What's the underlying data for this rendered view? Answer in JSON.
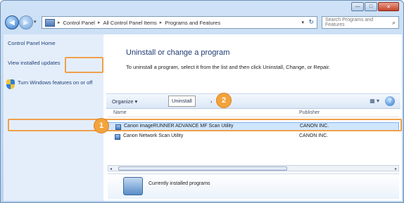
{
  "window": {
    "controls": {
      "minimize": "—",
      "maximize": "□",
      "close": "✕"
    }
  },
  "nav": {
    "back_icon": "◀",
    "forward_icon": "▶",
    "dropdown_icon": "▾",
    "address_parts": [
      "Control Panel",
      "All Control Panel Items",
      "Programs and Features"
    ],
    "address_dropdown_icon": "▾",
    "refresh_icon": "↻",
    "search_placeholder": "Search Programs and Features",
    "search_icon": "⌕"
  },
  "sidebar": {
    "items": [
      {
        "label": "Control Panel Home"
      },
      {
        "label": "View installed updates"
      },
      {
        "label": "Turn Windows features on or off"
      }
    ]
  },
  "main": {
    "title": "Uninstall or change a program",
    "description": "To uninstall a program, select it from the list and then click Uninstall, Change, or Repair.",
    "toolbar": {
      "organize": "Organize ▾",
      "uninstall": "Uninstall",
      "views_icon": "▦ ▾",
      "help_icon": "?"
    },
    "list": {
      "columns": [
        "Name",
        "Publisher"
      ],
      "rows": [
        {
          "name": "Canon imageRUNNER ADVANCE MF Scan Utility",
          "publisher": "CANON INC."
        },
        {
          "name": "Canon Network Scan Utility",
          "publisher": "CANON INC."
        }
      ]
    },
    "scrollbar": {
      "left": "◂",
      "right": "▸"
    },
    "details": {
      "text": "Currently installed programs"
    }
  },
  "callouts": {
    "one": "1",
    "two": "2"
  },
  "colors": {
    "accent": "#f3a33c",
    "link": "#1f3f75",
    "selection": "#cfe6ff"
  }
}
